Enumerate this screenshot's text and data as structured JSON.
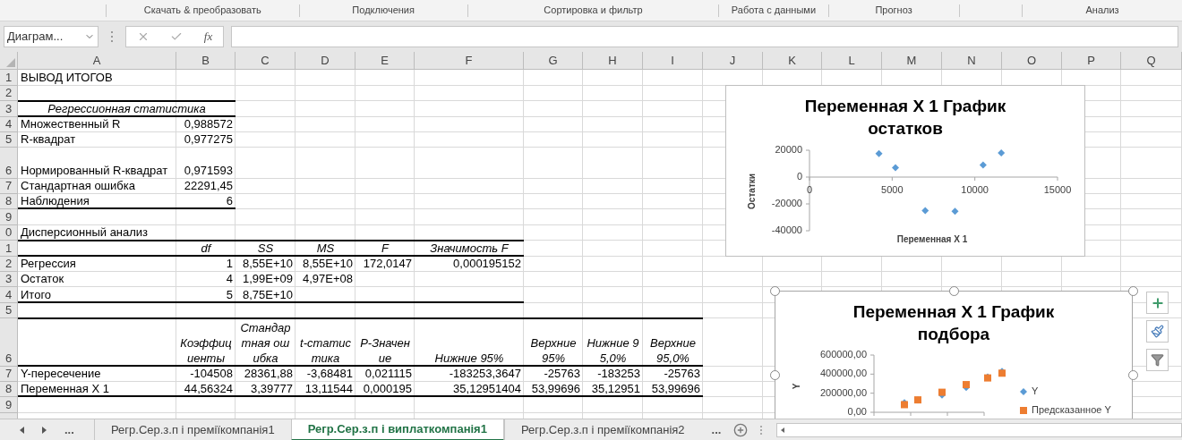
{
  "ribbon_groups": [
    "Скачать & преобразовать",
    "Подключения",
    "Сортировка и фильтр",
    "Работа с данными",
    "Прогноз",
    "Анализ"
  ],
  "formula_bar": {
    "name_box": "Диаграм...",
    "function_button": "fx"
  },
  "columns": [
    "A",
    "B",
    "C",
    "D",
    "E",
    "F",
    "G",
    "H",
    "I",
    "J",
    "K",
    "L",
    "M",
    "N",
    "O",
    "P",
    "Q"
  ],
  "rows": [
    {
      "header": "1",
      "cells": {
        "A": {
          "text": "ВЫВОД ИТОГОВ",
          "kind": "text"
        }
      }
    },
    {
      "header": "2",
      "cells": {}
    },
    {
      "header": "3",
      "cells": {
        "A": {
          "text": "Регрессионная статистика",
          "kind": "heading",
          "merged": true
        }
      }
    },
    {
      "header": "4",
      "cells": {
        "A": {
          "text": "Множественный R",
          "kind": "text"
        },
        "B": {
          "text": "0,988572",
          "kind": "number"
        }
      }
    },
    {
      "header": "5",
      "cells": {
        "A": {
          "text": "R-квадрат",
          "kind": "text"
        },
        "B": {
          "text": "0,977275",
          "kind": "number"
        }
      }
    },
    {
      "header": "6",
      "cells": {
        "A": {
          "text": "Нормированный R-квадрат",
          "kind": "text"
        },
        "B": {
          "text": "0,971593",
          "kind": "number"
        }
      }
    },
    {
      "header": "7",
      "cells": {
        "A": {
          "text": "Стандартная ошибка",
          "kind": "text"
        },
        "B": {
          "text": "22291,45",
          "kind": "number"
        }
      }
    },
    {
      "header": "8",
      "cells": {
        "A": {
          "text": "Наблюдения",
          "kind": "text"
        },
        "B": {
          "text": "6",
          "kind": "number"
        }
      }
    },
    {
      "header": "9",
      "cells": {}
    },
    {
      "header": "0",
      "cells": {
        "A": {
          "text": "Дисперсионный анализ",
          "kind": "text"
        }
      }
    },
    {
      "header": "1",
      "cells": {
        "B": {
          "text": "df",
          "kind": "heading"
        },
        "C": {
          "text": "SS",
          "kind": "heading"
        },
        "D": {
          "text": "MS",
          "kind": "heading"
        },
        "E": {
          "text": "F",
          "kind": "heading"
        },
        "F": {
          "text": "Значимость F",
          "kind": "heading"
        }
      }
    },
    {
      "header": "2",
      "cells": {
        "A": {
          "text": "Регрессия",
          "kind": "text"
        },
        "B": {
          "text": "1",
          "kind": "number"
        },
        "C": {
          "text": "8,55E+10",
          "kind": "number"
        },
        "D": {
          "text": "8,55E+10",
          "kind": "number"
        },
        "E": {
          "text": "172,0147",
          "kind": "number"
        },
        "F": {
          "text": "0,000195152",
          "kind": "number"
        }
      }
    },
    {
      "header": "3",
      "cells": {
        "A": {
          "text": "Остаток",
          "kind": "text"
        },
        "B": {
          "text": "4",
          "kind": "number"
        },
        "C": {
          "text": "1,99E+09",
          "kind": "number"
        },
        "D": {
          "text": "4,97E+08",
          "kind": "number"
        }
      }
    },
    {
      "header": "4",
      "cells": {
        "A": {
          "text": "Итого",
          "kind": "text"
        },
        "B": {
          "text": "5",
          "kind": "number"
        },
        "C": {
          "text": "8,75E+10",
          "kind": "number"
        }
      }
    },
    {
      "header": "5",
      "cells": {}
    },
    {
      "header": "6",
      "cells": {
        "B": {
          "text": "Коэффициенты",
          "kind": "heading"
        },
        "C": {
          "text": "Стандартная ошибка",
          "kind": "heading"
        },
        "D": {
          "text": "t-статистика",
          "kind": "heading"
        },
        "E": {
          "text": "P-Значение",
          "kind": "heading"
        },
        "F": {
          "text": "Нижние 95%",
          "kind": "heading"
        },
        "G": {
          "text": "Верхние 95%",
          "kind": "heading"
        },
        "H": {
          "text": "Нижние 95,0%",
          "kind": "heading"
        },
        "I": {
          "text": "Верхние 95,0%",
          "kind": "heading"
        }
      }
    },
    {
      "header": "7",
      "cells": {
        "A": {
          "text": "Y-пересечение",
          "kind": "text"
        },
        "B": {
          "text": "-104508",
          "kind": "number"
        },
        "C": {
          "text": "28361,88",
          "kind": "number"
        },
        "D": {
          "text": "-3,68481",
          "kind": "number"
        },
        "E": {
          "text": "0,021115",
          "kind": "number"
        },
        "F": {
          "text": "-183253,3647",
          "kind": "number"
        },
        "G": {
          "text": "-25763",
          "kind": "number"
        },
        "H": {
          "text": "-183253",
          "kind": "number"
        },
        "I": {
          "text": "-25763",
          "kind": "number"
        }
      }
    },
    {
      "header": "8",
      "cells": {
        "A": {
          "text": "Переменная X 1",
          "kind": "text"
        },
        "B": {
          "text": "44,56324",
          "kind": "number"
        },
        "C": {
          "text": "3,39777",
          "kind": "number"
        },
        "D": {
          "text": "13,11544",
          "kind": "number"
        },
        "E": {
          "text": "0,000195",
          "kind": "number"
        },
        "F": {
          "text": "35,12951404",
          "kind": "number"
        },
        "G": {
          "text": "53,99696",
          "kind": "number"
        },
        "H": {
          "text": "35,12951",
          "kind": "number"
        },
        "I": {
          "text": "53,99696",
          "kind": "number"
        }
      }
    },
    {
      "header": "9",
      "cells": {}
    }
  ],
  "charts": [
    {
      "chart_data": {
        "type": "scatter",
        "title": "Переменная X 1 График остатков",
        "xlabel": "Переменная X 1",
        "ylabel": "Остатки",
        "x": [
          4200,
          5200,
          7000,
          8800,
          10500,
          11600
        ],
        "series": [
          {
            "color": "#5b9bd5",
            "marker": "diamond",
            "values": [
              17500,
              7000,
              -25000,
              -25500,
              9000,
              18000
            ]
          }
        ],
        "xlim": [
          0,
          15000
        ],
        "ylim": [
          -40000,
          20000
        ],
        "xticks": [
          0,
          5000,
          10000,
          15000
        ],
        "yticks": [
          -40000,
          -20000,
          0,
          20000
        ]
      }
    },
    {
      "kind": "picture",
      "title": "Переменная X 1 График подбора",
      "ylabel": "Y",
      "y_tick_labels": [
        "600000,00",
        "400000,00",
        "200000,00",
        "0,00"
      ],
      "legend": [
        {
          "kind": "diamond",
          "label": "Y",
          "color": "#5b9bd5"
        },
        {
          "kind": "square",
          "label": "Предсказанное Y",
          "color": "#ed7d31"
        }
      ]
    }
  ],
  "sheet_tabs": {
    "more_left": "...",
    "tabs": [
      {
        "label": "Регр.Сер.з.п і преміїкомпанія1",
        "selected": false
      },
      {
        "label": "Регр.Сер.з.п і виплаткомпанія1",
        "selected": true
      },
      {
        "label": "Регр.Сер.з.п і преміїкомпанія2",
        "selected": false
      }
    ],
    "more_right": "..."
  }
}
